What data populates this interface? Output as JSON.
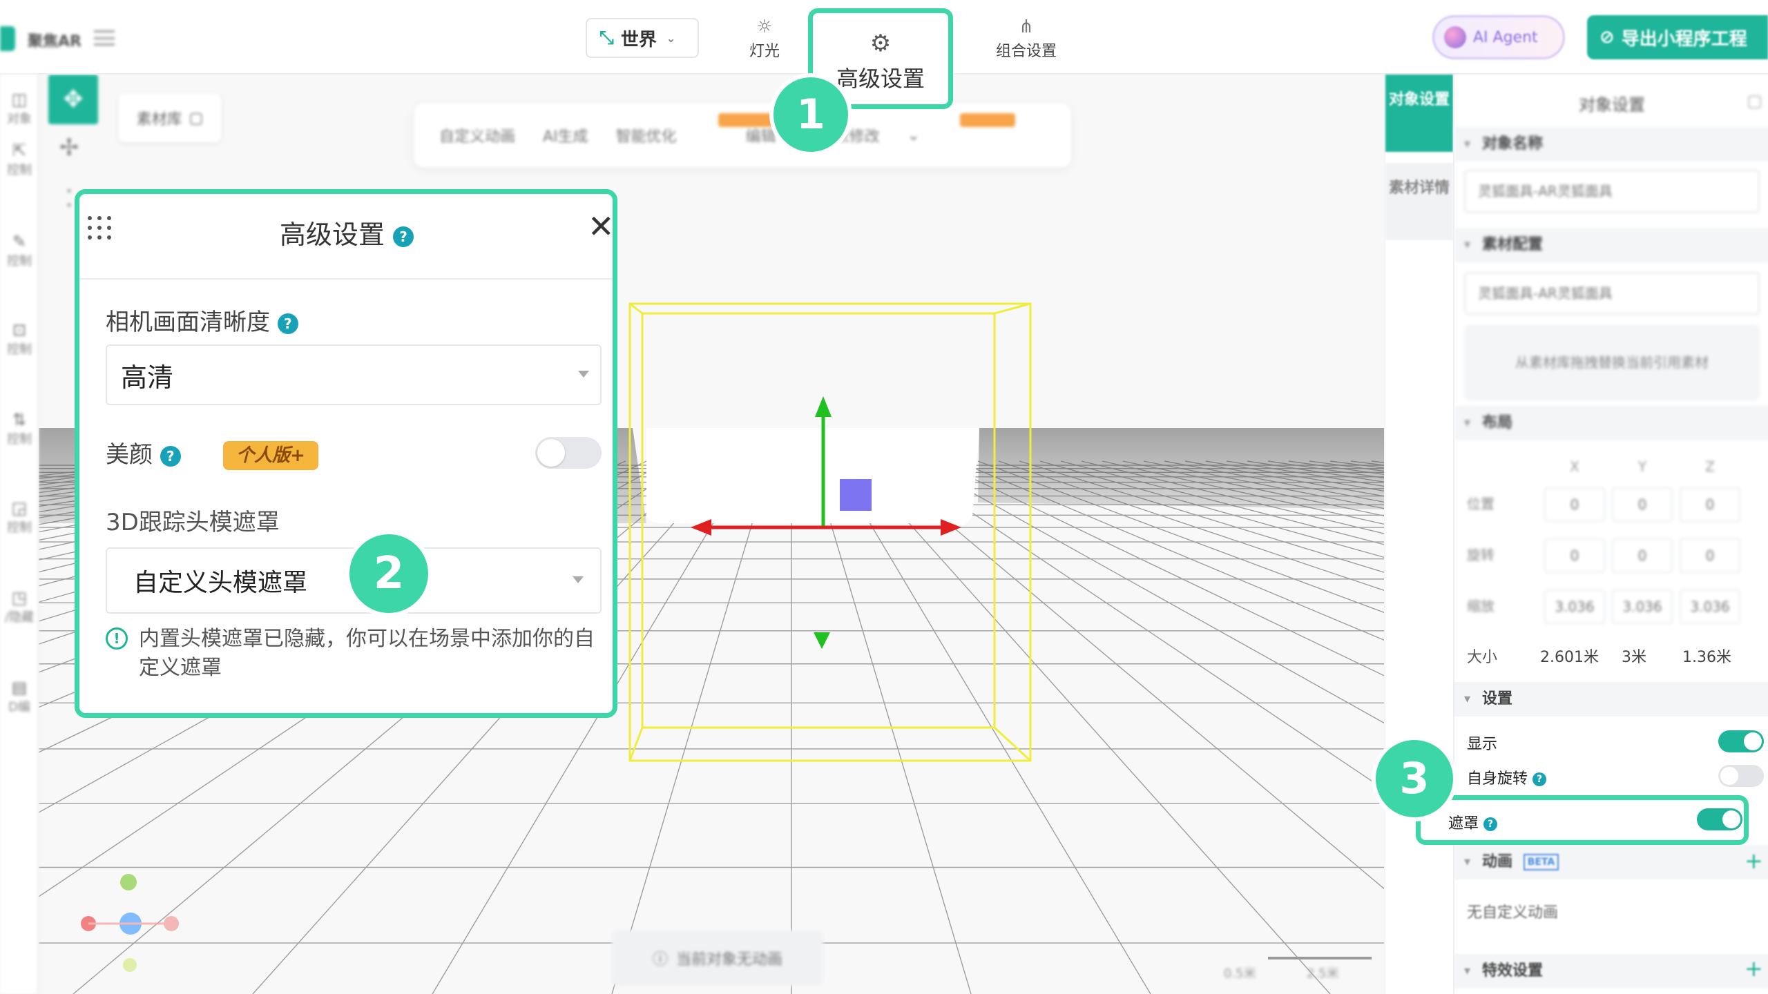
{
  "header": {
    "app_name": "聚焦AR",
    "world_label": "世界",
    "light_label": "灯光",
    "advanced_label": "高级设置",
    "partial_label": "置",
    "group_label": "组合设置",
    "ai_agent_label": "AI Agent",
    "export_label": "导出小程序工程"
  },
  "left_rail": [
    {
      "label": "对象"
    },
    {
      "label": "控制"
    },
    {
      "label": "控制"
    },
    {
      "label": "控制"
    },
    {
      "label": "控制"
    },
    {
      "label": "控制"
    },
    {
      "label": "/隐藏"
    },
    {
      "label": "D编"
    }
  ],
  "toolbar": {
    "material_lib": "素材库",
    "items": [
      "自定义动画",
      "AI生成",
      "智能优化",
      "编辑",
      "中心点修改"
    ]
  },
  "advanced_panel": {
    "title": "高级设置",
    "camera_label": "相机画面清晰度",
    "camera_value": "高清",
    "beauty_label": "美颜",
    "beauty_badge": "个人版+",
    "tracking_label": "3D跟踪头模遮罩",
    "tracking_value": "自定义头模遮罩",
    "note": "内置头模遮罩已隐藏，你可以在场景中添加你的自定义遮罩"
  },
  "callouts": {
    "one": "1",
    "two": "2",
    "three": "3"
  },
  "side_tabs": {
    "object": "对象设置",
    "material": "素材详情"
  },
  "object_panel": {
    "title": "对象设置",
    "name_section": "对象名称",
    "name_value": "灵狐面具-AR灵狐面具",
    "material_section": "素材配置",
    "material_value": "灵狐面具-AR灵狐面具",
    "material_hint": "从素材库拖拽替换当前引用素材",
    "layout_section": "布局",
    "axes": [
      "X",
      "Y",
      "Z"
    ],
    "position_label": "位置",
    "position": [
      "0",
      "0",
      "0"
    ],
    "rotation_label": "旋转",
    "rotation": [
      "0",
      "0",
      "0"
    ],
    "scale_label": "缩放",
    "scale": [
      "3.036",
      "3.036",
      "3.036"
    ],
    "size_label": "大小",
    "size": [
      "2.601米",
      "3米",
      "1.36米"
    ],
    "settings_section": "设置",
    "show_label": "显示",
    "show_on": true,
    "self_rotate_label": "自身旋转",
    "self_rotate_on": false,
    "mask_label": "遮罩",
    "mask_on": true,
    "animation_section": "动画",
    "beta_tag": "BETA",
    "no_animation": "无自定义动画",
    "effects_section": "特效设置"
  },
  "viewport": {
    "no_anim_label": "当前对象无动画",
    "scale_a": "0.5米",
    "scale_b": "2.5米"
  },
  "colors": {
    "accent": "#1fb59a",
    "highlight": "#3cd6a8",
    "badge": "#f5b43c"
  }
}
